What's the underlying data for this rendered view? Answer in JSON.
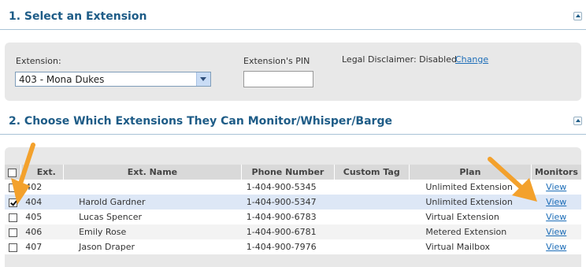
{
  "section1": {
    "title": "1. Select an Extension"
  },
  "extension": {
    "label": "Extension:",
    "selected": "403 - Mona Dukes"
  },
  "pin": {
    "label": "Extension's PIN",
    "value": ""
  },
  "disclaimer": {
    "label": "Legal Disclaimer:",
    "status": "Disabled",
    "change_label": "Change"
  },
  "section2": {
    "title": "2. Choose Which Extensions They Can Monitor/Whisper/Barge"
  },
  "table": {
    "headers": {
      "ext": "Ext.",
      "name": "Ext. Name",
      "phone": "Phone Number",
      "tag": "Custom Tag",
      "plan": "Plan",
      "monitors": "Monitors"
    },
    "rows": [
      {
        "ext": "402",
        "name": "",
        "phone": "1-404-900-5345",
        "tag": "",
        "plan": "Unlimited Extension",
        "view": "View",
        "checked": false
      },
      {
        "ext": "404",
        "name": "Harold Gardner",
        "phone": "1-404-900-5347",
        "tag": "",
        "plan": "Unlimited Extension",
        "view": "View",
        "checked": true
      },
      {
        "ext": "405",
        "name": "Lucas Spencer",
        "phone": "1-404-900-6783",
        "tag": "",
        "plan": "Virtual Extension",
        "view": "View",
        "checked": false
      },
      {
        "ext": "406",
        "name": "Emily Rose",
        "phone": "1-404-900-6781",
        "tag": "",
        "plan": "Metered Extension",
        "view": "View",
        "checked": false
      },
      {
        "ext": "407",
        "name": "Jason Draper",
        "phone": "1-404-900-7976",
        "tag": "",
        "plan": "Virtual Mailbox",
        "view": "View",
        "checked": false
      }
    ]
  },
  "colors": {
    "heading": "#1e5c87",
    "link": "#1e6eb8",
    "annotation_arrow": "#f3a12c",
    "selected_row": "#dde7f6"
  },
  "icons": {
    "collapse": "chevron-up-icon",
    "dropdown": "chevron-down-icon",
    "annotation": "arrow-icon"
  }
}
